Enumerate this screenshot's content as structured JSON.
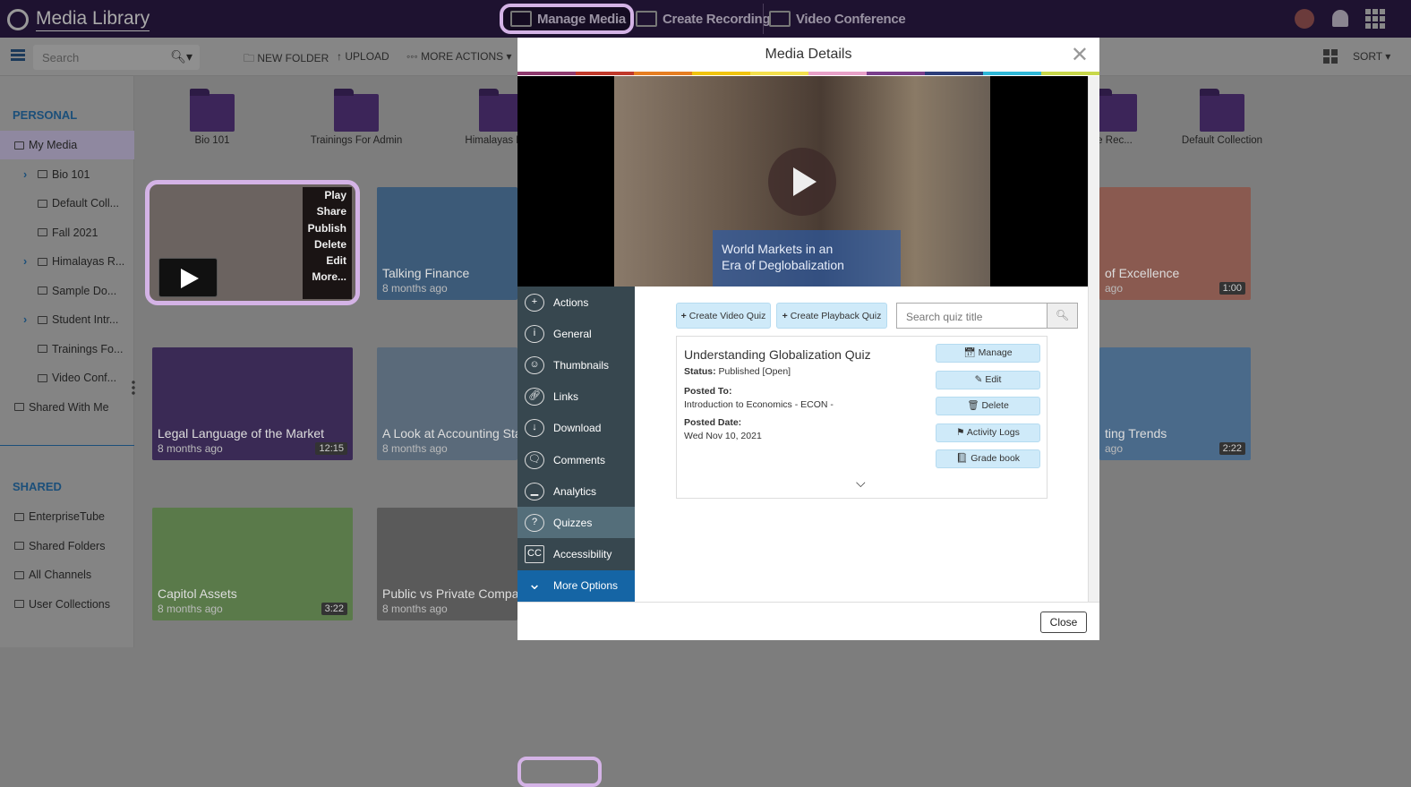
{
  "app": {
    "title": "Media Library"
  },
  "topnav": [
    {
      "label": "Manage Media",
      "icon": "folder-play-icon"
    },
    {
      "label": "Create Recording",
      "icon": "webcam-icon"
    },
    {
      "label": "Video Conference",
      "icon": "video-conference-icon"
    }
  ],
  "toolbar": {
    "search_placeholder": "Search",
    "new_folder": "NEW FOLDER",
    "upload": "UPLOAD",
    "more_actions": "MORE ACTIONS",
    "sort": "SORT"
  },
  "sidebar": {
    "personal_header": "PERSONAL",
    "personal": [
      {
        "label": "My Media",
        "selected": true
      },
      {
        "label": "Bio 101",
        "expand": true
      },
      {
        "label": "Default Coll..."
      },
      {
        "label": "Fall 2021"
      },
      {
        "label": "Himalayas R...",
        "expand": true
      },
      {
        "label": "Sample Do..."
      },
      {
        "label": "Student Intr...",
        "expand": true
      },
      {
        "label": "Trainings Fo..."
      },
      {
        "label": "Video Conf..."
      },
      {
        "label": "Shared With Me"
      }
    ],
    "shared_header": "SHARED",
    "shared": [
      {
        "label": "EnterpriseTube"
      },
      {
        "label": "Shared Folders"
      },
      {
        "label": "All Channels"
      },
      {
        "label": "User Collections"
      }
    ]
  },
  "folders": [
    "Bio 101",
    "Trainings For Admin",
    "Himalayas Re...",
    "e Rec...",
    "Default Collection"
  ],
  "hover_menu": [
    "Play",
    "Share",
    "Publish",
    "Delete",
    "Edit",
    "More..."
  ],
  "cards": [
    {
      "title": "Talking Finance",
      "age": "8 months ago"
    },
    {
      "title": "of Excellence",
      "age": "ago",
      "duration": "1:00"
    },
    {
      "title": "Legal Language of the Market",
      "age": "8 months ago",
      "duration": "12:15"
    },
    {
      "title": "A Look at Accounting Sta",
      "age": "8 months ago"
    },
    {
      "title": "ting Trends",
      "age": "ago",
      "duration": "2:22"
    },
    {
      "title": "Capitol Assets",
      "age": "8 months ago",
      "duration": "3:22"
    },
    {
      "title": "Public vs Private Compan",
      "age": "8 months ago"
    }
  ],
  "modal": {
    "title": "Media Details",
    "video_caption_1": "World Markets in an",
    "video_caption_2": "Era of Deglobalization",
    "close": "Close",
    "rainbow": [
      "#8e3a6e",
      "#c0392b",
      "#e67e22",
      "#f1c40f",
      "#f4e04d",
      "#e8a0c8",
      "#7b3f8c",
      "#2c3e7a",
      "#2eb8d8",
      "#c8d84a"
    ],
    "nav": [
      {
        "label": "Actions",
        "icon": "plus-circle-icon"
      },
      {
        "label": "General",
        "icon": "info-icon"
      },
      {
        "label": "Thumbnails",
        "icon": "thumbnails-icon"
      },
      {
        "label": "Links",
        "icon": "link-icon"
      },
      {
        "label": "Download",
        "icon": "download-icon"
      },
      {
        "label": "Comments",
        "icon": "comments-icon"
      },
      {
        "label": "Analytics",
        "icon": "analytics-icon"
      },
      {
        "label": "Quizzes",
        "icon": "question-icon",
        "selected": true
      },
      {
        "label": "Accessibility",
        "icon": "cc-icon"
      },
      {
        "label": "More Options",
        "icon": "chevron-down-icon"
      }
    ],
    "create_video_quiz": "Create Video Quiz",
    "create_playback_quiz": "Create Playback Quiz",
    "search_quiz_placeholder": "Search quiz title",
    "quiz": {
      "title": "Understanding Globalization Quiz",
      "status_label": "Status:",
      "status": "Published [Open]",
      "posted_to_label": "Posted To:",
      "posted_to": "Introduction to Economics - ECON -",
      "posted_date_label": "Posted Date:",
      "posted_date": "Wed Nov 10, 2021",
      "actions": [
        {
          "label": "Manage",
          "icon": "calendar-icon"
        },
        {
          "label": "Edit",
          "icon": "edit-icon"
        },
        {
          "label": "Delete",
          "icon": "trash-icon"
        },
        {
          "label": "Activity Logs",
          "icon": "flag-icon"
        },
        {
          "label": "Grade book",
          "icon": "book-icon"
        }
      ]
    }
  }
}
